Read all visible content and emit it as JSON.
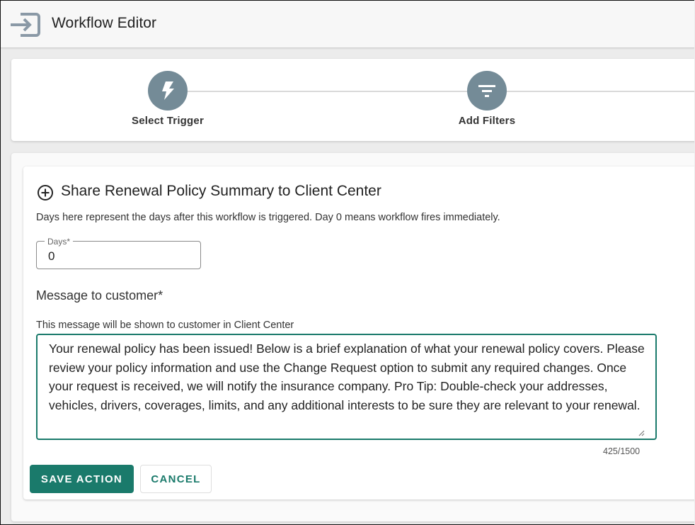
{
  "app": {
    "title": "Workflow Editor",
    "exit_icon": "exit-arrow-icon"
  },
  "stepper": {
    "steps": [
      {
        "label": "Select Trigger",
        "icon": "lightning-bolt-icon"
      },
      {
        "label": "Add Filters",
        "icon": "filter-icon"
      }
    ]
  },
  "action": {
    "icon": "circle-plus-icon",
    "title": "Share Renewal Policy Summary to Client Center",
    "days_help": "Days here represent the days after this workflow is triggered. Day 0 means workflow fires immediately.",
    "days_label": "Days*",
    "days_value": "0",
    "message_label": "Message to customer*",
    "message_help": "This message will be shown to customer in Client Center",
    "message_value": "Your renewal policy has been issued! Below is a brief explanation of what your renewal policy covers. Please review your policy information and use the Change Request option to submit any required changes. Once your request is received, we will notify the insurance company. Pro Tip: Double-check your addresses, vehicles, drivers, coverages, limits, and any additional interests to be sure they are relevant to your renewal.",
    "char_count": "425/1500"
  },
  "buttons": {
    "save": "SAVE ACTION",
    "cancel": "CANCEL"
  },
  "colors": {
    "primary": "#1a7a6b",
    "step_circle": "#748b97"
  }
}
